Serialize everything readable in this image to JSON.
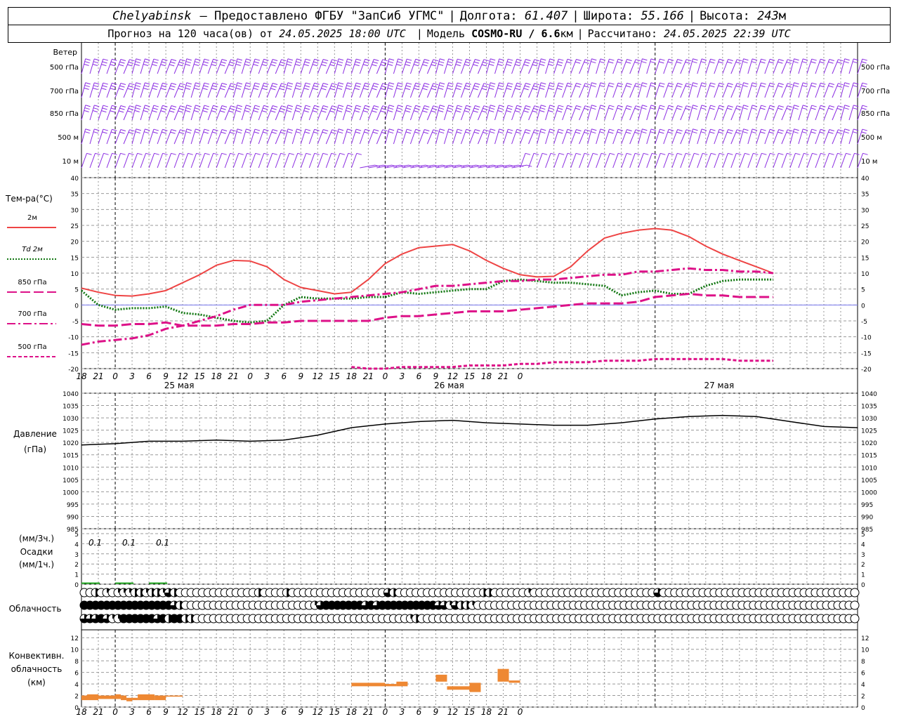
{
  "header": {
    "city": "Chelyabinsk",
    "provided": "– Предоставлено ФГБУ \"ЗапСиб УГМС\"",
    "lon_label": "Долгота:",
    "lon": "61.407",
    "lat_label": "Широта:",
    "lat": "55.166",
    "alt_label": "Высота:",
    "alt": "243",
    "alt_unit": "м",
    "forecast_text": "Прогноз на 120 часа(ов) от",
    "forecast_time": "24.05.2025 18:00 UTC",
    "model_label": "Модель",
    "model": "COSMO-RU / 6.6",
    "model_unit": "км",
    "calc_label": "Рассчитано:",
    "calc_time": "24.05.2025 22:39 UTC"
  },
  "labels": {
    "wind_title": "Ветер",
    "wind_levels": [
      "500 гПа",
      "700 гПа",
      "850 гПа",
      "500 м",
      "10 м"
    ],
    "temp_title": "Тем-ра(°С)",
    "legend": [
      "2м",
      "Td 2м",
      "850 гПа",
      "700 гПа",
      "500 гПа"
    ],
    "pressure_title": "Давление",
    "pressure_unit": "(гПа)",
    "precip_unit_top": "(мм/3ч.)",
    "precip_title": "Осадки",
    "precip_unit_bottom": "(мм/1ч.)",
    "cloud_title": "Облачность",
    "conv_title": [
      "Конвективн.",
      "облачность",
      "(км)"
    ],
    "x_ticks": [
      "18",
      "21",
      "0",
      "3",
      "6",
      "9",
      "12",
      "15",
      "18",
      "21",
      "0",
      "3",
      "6",
      "9",
      "12",
      "15",
      "18",
      "21",
      "0",
      "3",
      "6",
      "9",
      "12",
      "15",
      "18",
      "21",
      "0"
    ],
    "dates": [
      "25 мая",
      "26 мая",
      "27 мая"
    ],
    "precip_values": [
      "0.1",
      "0.1",
      "0.1"
    ]
  },
  "colors": {
    "wind": "#8a2be2",
    "t2m": "#ee4444",
    "td2m": "#117711",
    "t850": "#dd1188",
    "t700": "#dd1188",
    "t500": "#dd1188",
    "pressure": "#000000",
    "precip": "#22aa22",
    "convective": "#ee8833",
    "zero_line": "#7777ee"
  },
  "chart_data": [
    {
      "type": "line",
      "title": "Тем-ра(°С)",
      "ylim": [
        -20,
        40
      ],
      "x_hours": [
        0,
        3,
        6,
        9,
        12,
        15,
        18,
        21,
        24,
        27,
        30,
        33,
        36,
        39,
        42,
        45,
        48,
        51,
        54,
        57,
        60,
        63,
        66,
        69,
        72,
        75,
        78,
        81,
        84,
        87,
        90,
        93,
        96,
        99,
        102,
        105,
        108,
        111,
        114,
        117,
        120,
        123,
        126,
        129,
        132,
        135,
        138
      ],
      "series": [
        {
          "name": "2м",
          "style": "solid",
          "values": [
            5.3,
            4.0,
            3.0,
            2.8,
            3.5,
            4.5,
            7.0,
            9.5,
            12.5,
            14.0,
            13.8,
            12.0,
            8.0,
            5.5,
            4.5,
            3.5,
            4.0,
            8.0,
            13.0,
            16.0,
            18.0,
            18.5,
            19.0,
            17.0,
            14.0,
            11.5,
            9.5,
            8.8,
            9.0,
            12.0,
            17.0,
            21.0,
            22.5,
            23.5,
            24.0,
            23.5,
            21.5,
            18.5,
            16.0,
            14.0,
            12.0,
            10.0
          ]
        },
        {
          "name": "Td 2м",
          "style": "dot",
          "values": [
            4.5,
            0.0,
            -1.5,
            -1.0,
            -1.0,
            -0.5,
            -2.5,
            -3.0,
            -4.0,
            -5.0,
            -5.5,
            -5.0,
            0.0,
            2.5,
            2.0,
            2.0,
            2.0,
            2.5,
            2.5,
            4.0,
            3.5,
            4.0,
            4.5,
            5.0,
            5.0,
            7.5,
            8.0,
            7.5,
            7.0,
            7.0,
            6.5,
            6.0,
            3.0,
            4.0,
            4.5,
            3.5,
            3.5,
            6.0,
            7.5,
            8.0,
            8.0,
            8.0
          ]
        },
        {
          "name": "850 гПа",
          "style": "longdash",
          "values": [
            -6.0,
            -6.5,
            -6.5,
            -6.0,
            -6.0,
            -5.5,
            -6.5,
            -6.5,
            -6.5,
            -6.0,
            -6.0,
            -5.5,
            -5.5,
            -5.0,
            -5.0,
            -5.0,
            -5.0,
            -5.0,
            -4.0,
            -3.5,
            -3.5,
            -3.0,
            -2.5,
            -2.0,
            -2.0,
            -2.0,
            -1.5,
            -1.0,
            -0.5,
            0.0,
            0.5,
            0.5,
            0.5,
            1.0,
            2.5,
            3.0,
            3.5,
            3.0,
            3.0,
            2.5,
            2.5,
            2.5
          ]
        },
        {
          "name": "700 гПа",
          "style": "dashdot",
          "values": [
            -12.5,
            -11.5,
            -11.0,
            -10.5,
            -9.5,
            -7.5,
            -6.5,
            -5.0,
            -3.5,
            -1.5,
            0.0,
            0.0,
            0.0,
            1.0,
            1.5,
            2.0,
            2.5,
            3.0,
            3.5,
            4.0,
            5.0,
            6.0,
            6.0,
            6.5,
            7.0,
            7.5,
            7.5,
            8.0,
            8.0,
            8.5,
            9.0,
            9.5,
            9.5,
            10.5,
            10.5,
            11.0,
            11.5,
            11.0,
            11.0,
            10.5,
            10.5,
            10.0
          ]
        },
        {
          "name": "500 гПа",
          "style": "shortdash",
          "x_hours_start": 48,
          "values": [
            -19.5,
            -20.0,
            -20.0,
            -19.5,
            -19.5,
            -19.5,
            -19.5,
            -19.0,
            -19.0,
            -19.0,
            -18.5,
            -18.5,
            -18.0,
            -18.0,
            -18.0,
            -17.5,
            -17.5,
            -17.5,
            -17.0,
            -17.0,
            -17.0,
            -17.0,
            -17.0,
            -17.5,
            -17.5,
            -17.5
          ]
        }
      ]
    },
    {
      "type": "line",
      "title": "Давление",
      "ylabel": "(гПа)",
      "ylim": [
        985,
        1040
      ],
      "x_hours": [
        0,
        6,
        12,
        18,
        24,
        30,
        36,
        42,
        48,
        54,
        60,
        66,
        72,
        78,
        84,
        90,
        96,
        102,
        108,
        114,
        120,
        126,
        132,
        138
      ],
      "series": [
        {
          "name": "Давление",
          "values": [
            1019.0,
            1019.5,
            1020.5,
            1020.5,
            1021.0,
            1020.5,
            1021.0,
            1023.0,
            1026.0,
            1027.5,
            1028.5,
            1029.0,
            1028.0,
            1027.5,
            1027.0,
            1027.0,
            1028.0,
            1029.5,
            1030.5,
            1031.0,
            1030.5,
            1028.5,
            1026.5,
            1026.0
          ]
        }
      ]
    },
    {
      "type": "bar",
      "title": "Осадки",
      "ylim": [
        0,
        5
      ],
      "labels": [
        "0.1",
        "0.1",
        "0.1"
      ],
      "x_hours": [
        0,
        6,
        12
      ],
      "values": [
        0.1,
        0.1,
        0.1
      ]
    },
    {
      "type": "bar",
      "title": "Конвективн. облачность (км)",
      "ylim": [
        0,
        13
      ],
      "bars": [
        {
          "h0": 0,
          "h1": 1,
          "bottom": 1.2,
          "top": 2.0
        },
        {
          "h0": 1,
          "h1": 3,
          "bottom": 1.2,
          "top": 2.2
        },
        {
          "h0": 3,
          "h1": 6,
          "bottom": 1.4,
          "top": 2.0
        },
        {
          "h0": 6,
          "h1": 7,
          "bottom": 1.4,
          "top": 2.2
        },
        {
          "h0": 7,
          "h1": 8,
          "bottom": 1.2,
          "top": 2.0
        },
        {
          "h0": 8,
          "h1": 9,
          "bottom": 1.0,
          "top": 1.6
        },
        {
          "h0": 9,
          "h1": 10,
          "bottom": 1.2,
          "top": 1.6
        },
        {
          "h0": 10,
          "h1": 13,
          "bottom": 1.2,
          "top": 2.2
        },
        {
          "h0": 13,
          "h1": 15,
          "bottom": 1.2,
          "top": 2.0
        },
        {
          "h0": 15,
          "h1": 18,
          "bottom": 1.8,
          "top": 2.0
        },
        {
          "h0": 48,
          "h1": 54,
          "bottom": 3.6,
          "top": 4.2
        },
        {
          "h0": 54,
          "h1": 56,
          "bottom": 3.6,
          "top": 4.0
        },
        {
          "h0": 56,
          "h1": 58,
          "bottom": 3.6,
          "top": 4.4
        },
        {
          "h0": 63,
          "h1": 65,
          "bottom": 4.4,
          "top": 5.6
        },
        {
          "h0": 65,
          "h1": 69,
          "bottom": 3.0,
          "top": 3.6
        },
        {
          "h0": 69,
          "h1": 71,
          "bottom": 2.6,
          "top": 4.2
        },
        {
          "h0": 74,
          "h1": 76,
          "bottom": 4.4,
          "top": 6.6
        },
        {
          "h0": 76,
          "h1": 78,
          "bottom": 4.2,
          "top": 4.6
        }
      ]
    }
  ],
  "clouds": {
    "rows": [
      [
        "o",
        "o",
        "h",
        "o",
        "q",
        "o",
        "q",
        "q",
        "q",
        "h",
        "h",
        "q",
        "h",
        "h",
        "q",
        "t",
        "h",
        "o",
        "o",
        "o",
        "o",
        "o",
        "o",
        "o",
        "o",
        "o",
        "o",
        "o",
        "o",
        "o",
        "o",
        "h",
        "o",
        "o",
        "o",
        "o",
        "h",
        "o",
        "o",
        "o",
        "o",
        "o",
        "o",
        "o",
        "o",
        "o",
        "o",
        "o",
        "o",
        "o",
        "o",
        "o",
        "o",
        "o",
        "t",
        "h",
        "o",
        "o",
        "o",
        "o",
        "o",
        "o",
        "o",
        "o",
        "o",
        "o",
        "o",
        "o",
        "o",
        "o",
        "o",
        "h",
        "h",
        "o",
        "o",
        "o",
        "o",
        "o",
        "o",
        "q",
        "o",
        "o",
        "o",
        "o",
        "o",
        "o",
        "o",
        "o",
        "o",
        "o",
        "o",
        "o",
        "o",
        "o",
        "o",
        "o",
        "o",
        "o",
        "o",
        "o",
        "o",
        "o",
        "t",
        "o",
        "o",
        "o",
        "o",
        "o",
        "o",
        "o",
        "o",
        "o",
        "o",
        "o",
        "o",
        "o",
        "o",
        "o",
        "o",
        "o",
        "o",
        "o",
        "o",
        "o",
        "o",
        "o",
        "o",
        "o",
        "o",
        "o",
        "o",
        "o",
        "o",
        "o",
        "o",
        "o",
        "o",
        "o",
        "o",
        "o",
        "o",
        "o"
      ],
      [
        "f",
        "f",
        "f",
        "f",
        "f",
        "f",
        "f",
        "f",
        "f",
        "f",
        "f",
        "f",
        "f",
        "f",
        "f",
        "f",
        "t",
        "h",
        "o",
        "o",
        "o",
        "o",
        "o",
        "o",
        "o",
        "o",
        "o",
        "o",
        "o",
        "o",
        "o",
        "o",
        "o",
        "o",
        "o",
        "o",
        "o",
        "o",
        "o",
        "o",
        "o",
        "q",
        "t",
        "f",
        "f",
        "f",
        "f",
        "f",
        "f",
        "f",
        "t",
        "f",
        "t",
        "f",
        "f",
        "f",
        "f",
        "f",
        "f",
        "f",
        "f",
        "f",
        "f",
        "t",
        "t",
        "q",
        "t",
        "h",
        "h",
        "q",
        "o",
        "o",
        "o",
        "o",
        "o",
        "o",
        "o",
        "o",
        "o",
        "o",
        "o",
        "o",
        "o",
        "o",
        "o",
        "o",
        "o",
        "o",
        "o",
        "o",
        "o",
        "o",
        "o",
        "o",
        "o",
        "o",
        "o",
        "o",
        "o",
        "o",
        "o",
        "o",
        "o",
        "o",
        "o",
        "o",
        "o",
        "o",
        "o",
        "o",
        "o",
        "o",
        "o",
        "o",
        "o",
        "o",
        "o",
        "o",
        "o",
        "o",
        "o",
        "o",
        "o",
        "o",
        "o",
        "o",
        "o",
        "o",
        "o",
        "o",
        "o",
        "o",
        "o",
        "o",
        "o",
        "o",
        "o",
        "o",
        "o",
        "o",
        "o",
        "o"
      ],
      [
        "t",
        "t",
        "t",
        "f",
        "t",
        "q",
        "q",
        "f",
        "f",
        "f",
        "f",
        "f",
        "f",
        "t",
        "f",
        "h",
        "f",
        "f",
        "h",
        "h",
        "o",
        "o",
        "o",
        "o",
        "o",
        "o",
        "o",
        "o",
        "o",
        "o",
        "o",
        "o",
        "o",
        "o",
        "o",
        "o",
        "o",
        "o",
        "o",
        "o",
        "o",
        "o",
        "o",
        "o",
        "o",
        "o",
        "o",
        "o",
        "o",
        "o",
        "o",
        "o",
        "o",
        "o",
        "o",
        "o",
        "o",
        "o",
        "q",
        "h",
        "o",
        "o",
        "o",
        "o",
        "o",
        "o",
        "o",
        "o",
        "o",
        "o",
        "o",
        "o",
        "o",
        "o",
        "o",
        "o",
        "o",
        "o",
        "o",
        "o",
        "o",
        "o",
        "o",
        "o",
        "o",
        "o",
        "o",
        "o",
        "o",
        "o",
        "o",
        "o",
        "o",
        "o",
        "o",
        "o",
        "o",
        "o",
        "o",
        "o",
        "o",
        "o",
        "o",
        "o",
        "o",
        "o",
        "o",
        "o",
        "o",
        "o",
        "o",
        "o",
        "o",
        "o",
        "o",
        "o",
        "o",
        "o",
        "o",
        "o",
        "o",
        "o",
        "o",
        "o",
        "o",
        "o",
        "o",
        "o",
        "o",
        "o",
        "o",
        "o",
        "o",
        "o",
        "o",
        "o",
        "o",
        "o",
        "o",
        "o",
        "o",
        "o"
      ]
    ]
  }
}
